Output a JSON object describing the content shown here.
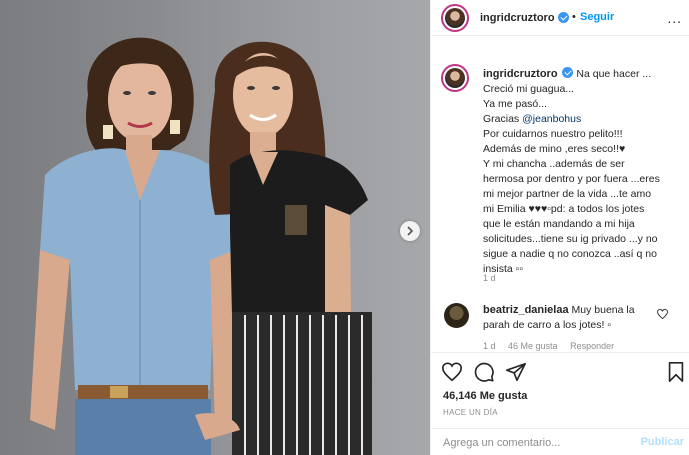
{
  "header": {
    "username": "ingridcruztoro",
    "separator": "•",
    "follow_label": "Seguir",
    "more_label": "..."
  },
  "caption": {
    "username": "ingridcruztoro",
    "lines": [
      "Na que hacer ...",
      "Creció mi guagua...",
      "Ya me pasó...",
      "Gracias",
      "Por cuidarnos nuestro pelito!!!",
      "Además de mino ,eres seco!!♥",
      "Y mi chancha ..además de ser",
      "hermosa por dentro y por fuera ...eres",
      "mi mejor partner de la vida ...te amo",
      "mi Emilia ♥♥♥▫pd: a todos los jotes",
      "que le están mandando a mi hija",
      "solicitudes...tiene su ig privado ...y no",
      "sigue a nadie q no conozca ..así q no",
      "insista ▫▫"
    ],
    "mention": "@jeanbohus",
    "time": "1 d"
  },
  "comment": {
    "username": "beatriz_danielaa",
    "text": "Muy buena la parah de carro a los jotes! ▫",
    "time": "1 d",
    "likes": "46 Me gusta",
    "reply": "Responder"
  },
  "actions": {
    "icons": [
      "heart-icon",
      "comment-icon",
      "share-icon",
      "bookmark-icon"
    ]
  },
  "likes_label": "46,146 Me gusta",
  "post_time": "HACE UN DÍA",
  "add_comment": {
    "placeholder": "Agrega un comentario...",
    "publish_label": "Publicar"
  },
  "colors": {
    "accent": "#0095f6",
    "verified": "#3897f0",
    "publish_disabled": "#b2dffc",
    "muted": "#8e8e8e"
  }
}
